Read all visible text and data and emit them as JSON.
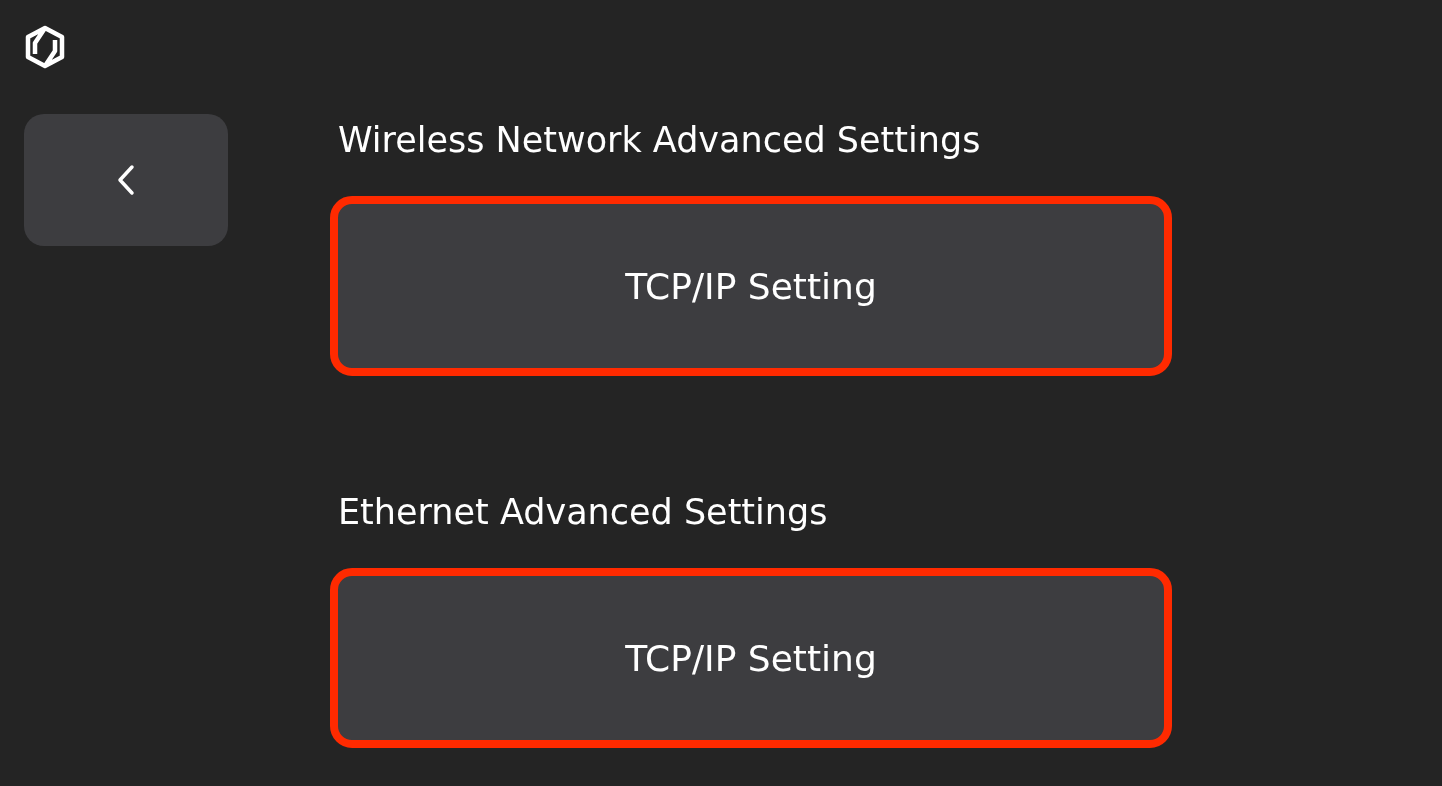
{
  "sections": [
    {
      "heading": "Wireless Network Advanced Settings",
      "button": {
        "label": "TCP/IP Setting",
        "highlighted": true
      }
    },
    {
      "heading": "Ethernet Advanced Settings",
      "button": {
        "label": "TCP/IP Setting",
        "highlighted": true
      }
    }
  ]
}
